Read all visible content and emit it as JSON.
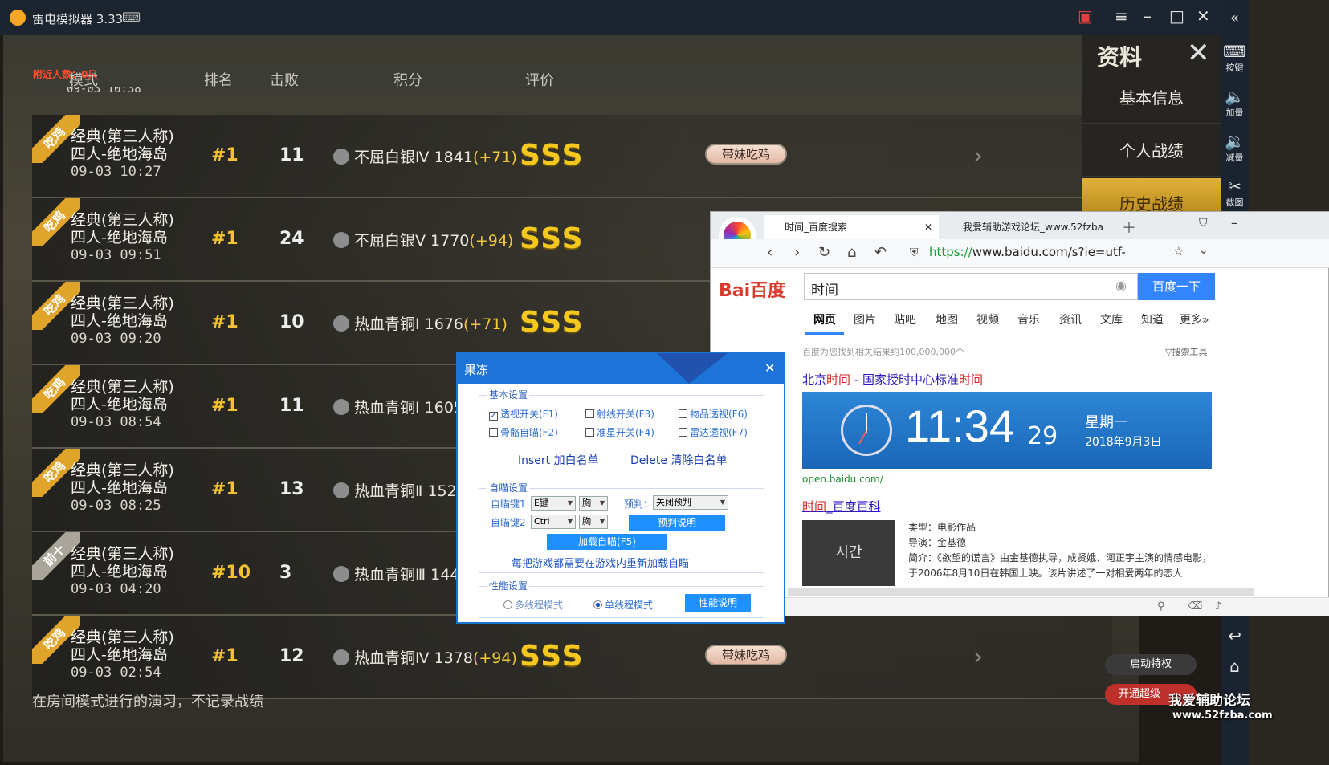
{
  "emulator": {
    "title": "雷电模拟器 3.33"
  },
  "overlay_status": "附近人数：0只",
  "table": {
    "headers": [
      "模式",
      "排名",
      "击败",
      "积分",
      "评价"
    ],
    "partial_date": "09-03 10:38",
    "rows": [
      {
        "ribbon": "吃鸡",
        "mode": "经典(第三人称)",
        "map": "四人-绝地海岛",
        "date": "09-03 10:27",
        "rank": "#1",
        "kills": "11",
        "tier": "不屈白银Ⅳ",
        "score": "1841",
        "delta": "(+71)",
        "grade": "SSS",
        "tag": "带妹吃鸡"
      },
      {
        "ribbon": "吃鸡",
        "mode": "经典(第三人称)",
        "map": "四人-绝地海岛",
        "date": "09-03 09:51",
        "rank": "#1",
        "kills": "24",
        "tier": "不屈白银Ⅴ",
        "score": "1770",
        "delta": "(+94)",
        "grade": "SSS",
        "tag": ""
      },
      {
        "ribbon": "吃鸡",
        "mode": "经典(第三人称)",
        "map": "四人-绝地海岛",
        "date": "09-03 09:20",
        "rank": "#1",
        "kills": "10",
        "tier": "热血青铜Ⅰ",
        "score": "1676",
        "delta": "(+71)",
        "grade": "SSS",
        "tag": ""
      },
      {
        "ribbon": "吃鸡",
        "mode": "经典(第三人称)",
        "map": "四人-绝地海岛",
        "date": "09-03 08:54",
        "rank": "#1",
        "kills": "11",
        "tier": "热血青铜Ⅰ",
        "score": "1605",
        "delta": "",
        "grade": "",
        "tag": ""
      },
      {
        "ribbon": "吃鸡",
        "mode": "经典(第三人称)",
        "map": "四人-绝地海岛",
        "date": "09-03 08:25",
        "rank": "#1",
        "kills": "13",
        "tier": "热血青铜Ⅱ",
        "score": "1525",
        "delta": "",
        "grade": "",
        "tag": ""
      },
      {
        "ribbon": "前十",
        "mode": "经典(第三人称)",
        "map": "四人-绝地海岛",
        "date": "09-03 04:20",
        "rank": "#10",
        "kills": "3",
        "tier": "热血青铜Ⅲ",
        "score": "1445",
        "delta": "",
        "grade": "",
        "tag": ""
      },
      {
        "ribbon": "吃鸡",
        "mode": "经典(第三人称)",
        "map": "四人-绝地海岛",
        "date": "09-03 02:54",
        "rank": "#1",
        "kills": "12",
        "tier": "热血青铜Ⅳ",
        "score": "1378",
        "delta": "(+94)",
        "grade": "SSS",
        "tag": "带妹吃鸡"
      }
    ]
  },
  "footnote": "在房间模式进行的演习，不记录战绩",
  "side_panel": {
    "title": "资料",
    "items": [
      "基本信息",
      "个人战绩",
      "历史战绩"
    ]
  },
  "toolbar": [
    "按键",
    "加量",
    "减量",
    "截图"
  ],
  "bottom_buttons": {
    "privilege": "启动特权",
    "super": "开通超级"
  },
  "browser": {
    "tab1": "时间_百度搜索",
    "tab2": "我爱辅助游戏论坛_www.52fzba",
    "url_scheme": "https://",
    "url_rest": "www.baidu.com/s?ie=utf-",
    "logo": "Bai百度",
    "query": "时间",
    "search_btn": "百度一下",
    "tabs": [
      "网页",
      "图片",
      "贴吧",
      "地图",
      "视频",
      "音乐",
      "资讯",
      "文库",
      "知道",
      "更多»"
    ],
    "stats": "百度为您找到相关结果约100,000,000个",
    "tools": "搜索工具",
    "r1_title_a": "北京",
    "r1_title_b": "时间",
    "r1_title_c": " - 国家授时中心标准",
    "r1_title_d": "时间",
    "clock_time": "11:34",
    "clock_sec": "29",
    "clock_weekday": "星期一",
    "clock_date": "2018年9月3日",
    "r1_url": "open.baidu.com/",
    "r2_title_a": "时间",
    "r2_title_b": "_百度百科",
    "poster": "시간",
    "bk_type": "类型：电影作品",
    "bk_director": "导演：金基德",
    "bk_intro": "简介：《欲望的谎言》由金基德执导，成贤娥、河正宇主演的情感电影，于2006年8月10日在韩国上映。该片讲述了一对相爱两年的恋人"
  },
  "dialog": {
    "title": "果冻",
    "basic": {
      "label": "基本设置",
      "checks": [
        {
          "label": "透视开关(F1)",
          "checked": true
        },
        {
          "label": "射线开关(F3)",
          "checked": false
        },
        {
          "label": "物品透视(F6)",
          "checked": false
        },
        {
          "label": "骨骼自瞄(F2)",
          "checked": false
        },
        {
          "label": "准星开关(F4)",
          "checked": false
        },
        {
          "label": "雷达透视(F7)",
          "checked": false
        }
      ],
      "insert": "Insert 加白名单",
      "delete": "Delete 清除白名单"
    },
    "aim": {
      "label": "自瞄设置",
      "key1_label": "自瞄键1",
      "key1": "E键",
      "part1": "胸",
      "key2_label": "自瞄键2",
      "key2": "Ctrl",
      "part2": "胸",
      "predict_label": "预判：",
      "predict": "关闭预判",
      "predict_help": "预判说明",
      "load": "加载自瞄(F5)",
      "note": "每把游戏都需要在游戏内重新加载自瞄"
    },
    "perf": {
      "label": "性能设置",
      "multi": "多线程模式",
      "single": "单线程模式",
      "help": "性能说明"
    }
  },
  "watermark": {
    "line1": "我爱辅助论坛",
    "line2": "www.52fzba.com"
  }
}
